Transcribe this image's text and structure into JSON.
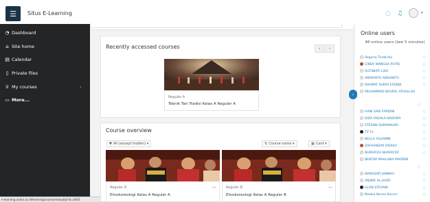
{
  "navbar": {
    "brand": "Situs E-Learning",
    "menu_icon": "☰",
    "chat_icon": "◌",
    "bell_icon": "♫",
    "caret": "▾"
  },
  "sidebar": {
    "items": [
      {
        "label": "Dashboard",
        "icon": "◔"
      },
      {
        "label": "Site home",
        "icon": "⌂"
      },
      {
        "label": "Calendar",
        "icon": "▤"
      },
      {
        "label": "Private files",
        "icon": "▯"
      },
      {
        "label": "My courses",
        "icon": "♕"
      },
      {
        "label": "More...",
        "icon": "▭"
      }
    ],
    "chevron": "‹",
    "status_url": "e-learning.untan.ac.id/learning/course/view.php?id=4443"
  },
  "recent": {
    "title": "Recently accessed courses",
    "prev": "‹",
    "next": "›",
    "course": {
      "category": "Reguler A",
      "name": "Teknik Tari Tradisi Kelas A Reguler A"
    }
  },
  "overview": {
    "title": "Course overview",
    "filter": "All (except hidden) ▾",
    "sort": "Course name ▾",
    "view": "Card ▾",
    "courses": [
      {
        "category": "Reguler A",
        "name": "Etnokoreologi Kelas A Reguler A",
        "menu": "—"
      },
      {
        "category": "Reguler B",
        "name": "Etnokoreologi Kelas A Reguler B",
        "menu": "—"
      }
    ]
  },
  "online": {
    "title": "Online users",
    "subtitle": "48 online users (last 5 minutes)",
    "toggle": "›",
    "users": [
      "Regoria Tindorika",
      "CINDY WANGSA PUTRI",
      "RUTINIATI LISA",
      "ABDIANTO ABDIANTO",
      "RAHMAT SURYA EFENDI",
      "MUHAMMAD NAUFAL ATHALLAH",
      "HANI SARI FARDINI",
      "DIZA FADHLA NADHIFA",
      "STEFANI DUMANAURI",
      "TZ Tz",
      "NELLA YULIANNI",
      "ZAFHANZAR FADHLY",
      "NURFAYZA NURFAYZA",
      "BENTAR MAULANA MADRIM",
      "WARASATI JANNAH",
      "ANDRE AL-HADY",
      "ILLEN STEVANI",
      "Nowka Novsa Kusnni"
    ],
    "msg_icon": "◌"
  }
}
